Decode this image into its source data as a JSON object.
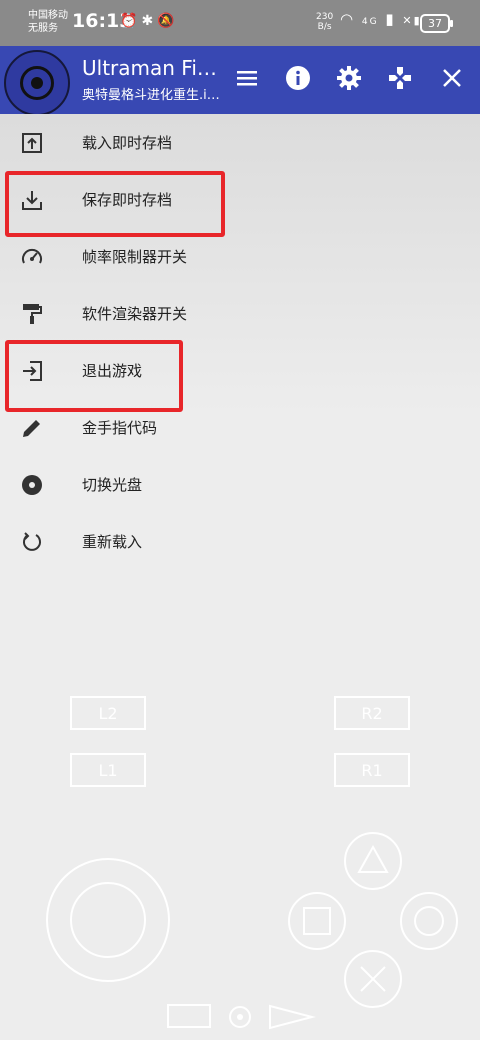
{
  "status_bar": {
    "carrier_1": "中国移动",
    "carrier_2": "无服务",
    "time": "16:13",
    "net_rate_value": "230",
    "net_rate_unit": "B/s",
    "network": "4G",
    "battery": "37"
  },
  "app_bar": {
    "title": "Ultraman Fi…",
    "subtitle": "奥特曼格斗进化重生.i…",
    "color": "#3848b3"
  },
  "menu": {
    "items": [
      {
        "label": "载入即时存档",
        "icon": "upload-icon"
      },
      {
        "label": "保存即时存档",
        "icon": "download-icon"
      },
      {
        "label": "帧率限制器开关",
        "icon": "speedometer-icon"
      },
      {
        "label": "软件渲染器开关",
        "icon": "paint-roller-icon"
      },
      {
        "label": "退出游戏",
        "icon": "exit-icon"
      },
      {
        "label": "金手指代码",
        "icon": "pencil-icon"
      },
      {
        "label": "切换光盘",
        "icon": "disc-icon"
      },
      {
        "label": "重新载入",
        "icon": "reload-icon"
      }
    ]
  },
  "gamepad": {
    "l2": "L2",
    "l1": "L1",
    "r2": "R2",
    "r1": "R1"
  },
  "highlight_color": "#e8262a"
}
